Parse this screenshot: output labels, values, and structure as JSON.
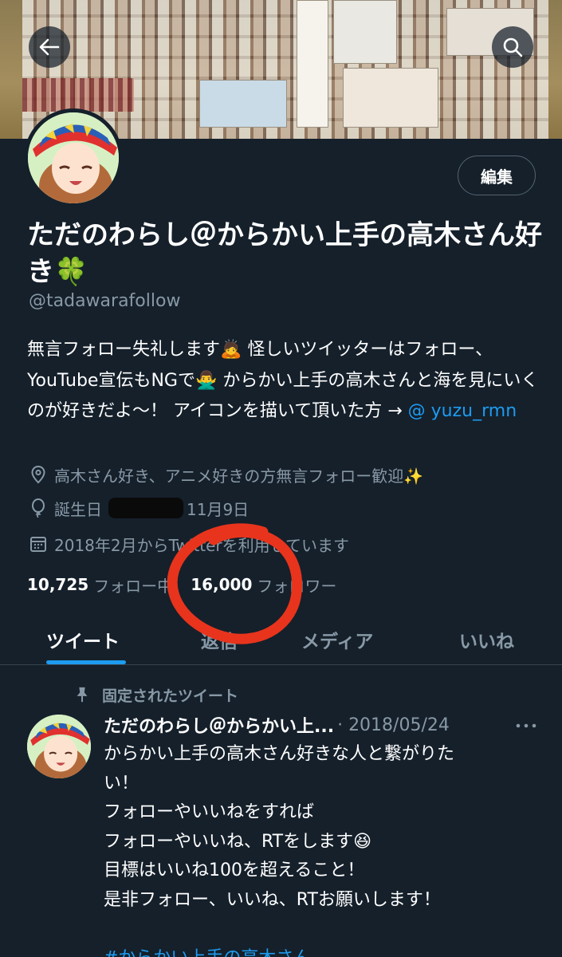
{
  "profile": {
    "display_name": "ただのわらし＠からかい上手の高木さん好き🍀",
    "handle": "@tadawarafollow",
    "edit_label": "編集",
    "bio": {
      "text1": "無言フォロー失礼します🙇 怪しいツイッターはフォロー、YouTube宣伝もNGで🙅‍♂️ からかい上手の高木さんと海を見にいくのが好きだよ〜！ アイコンを描いて頂いた方 → ",
      "link": "@ yuzu_rmn"
    },
    "location": "高木さん好き、アニメ好きの方無言フォロー歓迎✨",
    "birthday_label": "誕生日",
    "birthday_value": "11月9日",
    "joined": "2018年2月からTwitterを利用しています",
    "following_count": "10,725",
    "following_label": "フォロー中",
    "followers_count": "16,000",
    "followers_label": "フォロワー"
  },
  "tabs": [
    {
      "label": "ツイート",
      "active": true
    },
    {
      "label": "返信",
      "active": false
    },
    {
      "label": "メディア",
      "active": false
    },
    {
      "label": "いいね",
      "active": false
    }
  ],
  "pinned_tweet": {
    "pinned_label": "固定されたツイート",
    "author": "ただのわらし＠からかい上...",
    "date": "· 2018/05/24",
    "lines": [
      "からかい上手の高木さん好きな人と繋がりた",
      "い！",
      "フォローやいいねをすれば",
      "フォローやいいね、RTをします😆",
      "目標はいいね100を超えること！",
      "是非フォロー、いいね、RTお願いします！",
      "",
      "#からかい上手の高木さん"
    ]
  },
  "colors": {
    "background": "#15202b",
    "accent": "#1d9bf0",
    "secondary_text": "#8899a6",
    "annotation_red": "#e8341c"
  },
  "icons": {
    "back": "arrow-left-icon",
    "search": "search-icon",
    "location": "location-pin-icon",
    "birthday": "balloon-icon",
    "calendar": "calendar-icon",
    "pin": "pin-icon",
    "more": "more-horizontal-icon"
  }
}
